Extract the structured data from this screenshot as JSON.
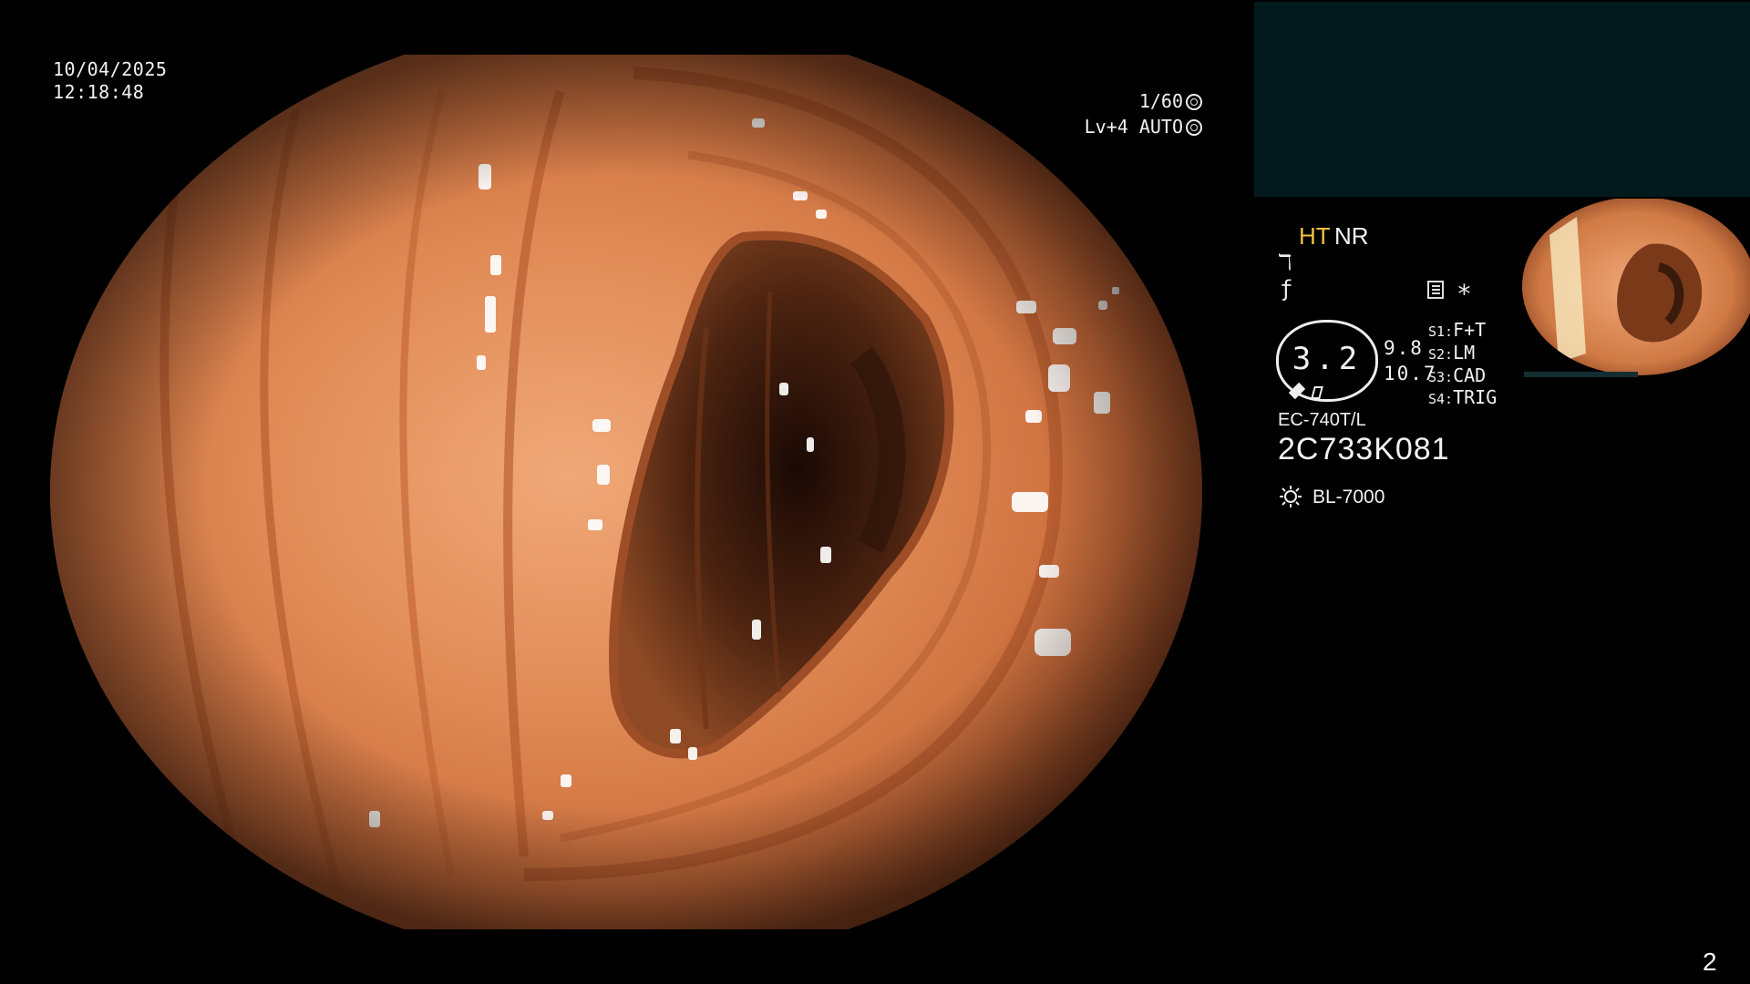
{
  "overlay": {
    "date": "10/04/2025",
    "time": "12:18:48",
    "shutter": "1/60",
    "level": "Lv+4 AUTO"
  },
  "panel": {
    "mode_ht": "HT",
    "mode_nr": "NR",
    "zoom_value": "3.2",
    "distance_a": "9.8",
    "distance_b": "10.7",
    "switches": [
      {
        "key": "S1:",
        "value": "F+T"
      },
      {
        "key": "S2:",
        "value": "LM"
      },
      {
        "key": "S3:",
        "value": "CAD"
      },
      {
        "key": "S4:",
        "value": "TRIG"
      }
    ],
    "scope_model": "EC-740T/L",
    "scope_serial": "2C733K081",
    "light_source": "BL-7000"
  },
  "footer": {
    "page_number": "2"
  },
  "colors": {
    "mucosa": "#d9844f",
    "lumen": "#2a140a",
    "highlight_ht": "#f1c33a",
    "teal_panel": "#021a1c"
  },
  "icons": [
    "clock-icon",
    "shutter-icon",
    "lens-icon",
    "light-icon",
    "menu-icon",
    "star-icon"
  ]
}
